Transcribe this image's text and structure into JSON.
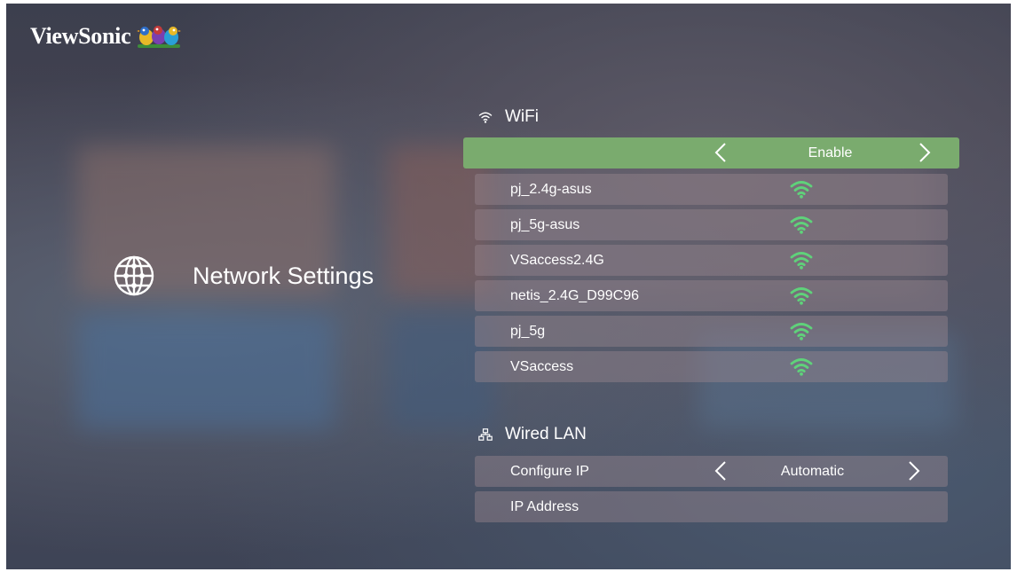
{
  "brand": {
    "name": "ViewSonic"
  },
  "category": {
    "label": "Network Settings",
    "icon": "globe-icon"
  },
  "wifi": {
    "title": "WiFi",
    "icon": "wifi-icon",
    "toggle": {
      "value": "Enable",
      "selected": true
    },
    "networks": [
      {
        "ssid": "pj_2.4g-asus"
      },
      {
        "ssid": "pj_5g-asus"
      },
      {
        "ssid": "VSaccess2.4G"
      },
      {
        "ssid": "netis_2.4G_D99C96"
      },
      {
        "ssid": "pj_5g"
      },
      {
        "ssid": "VSaccess"
      }
    ]
  },
  "wired_lan": {
    "title": "Wired LAN",
    "icon": "lan-icon",
    "configure_ip": {
      "label": "Configure IP",
      "value": "Automatic"
    },
    "ip_address": {
      "label": "IP Address",
      "value": ""
    }
  },
  "colors": {
    "selected_row": "#7aab6e",
    "row": "#8f7e88",
    "signal": "#5fd27a"
  }
}
